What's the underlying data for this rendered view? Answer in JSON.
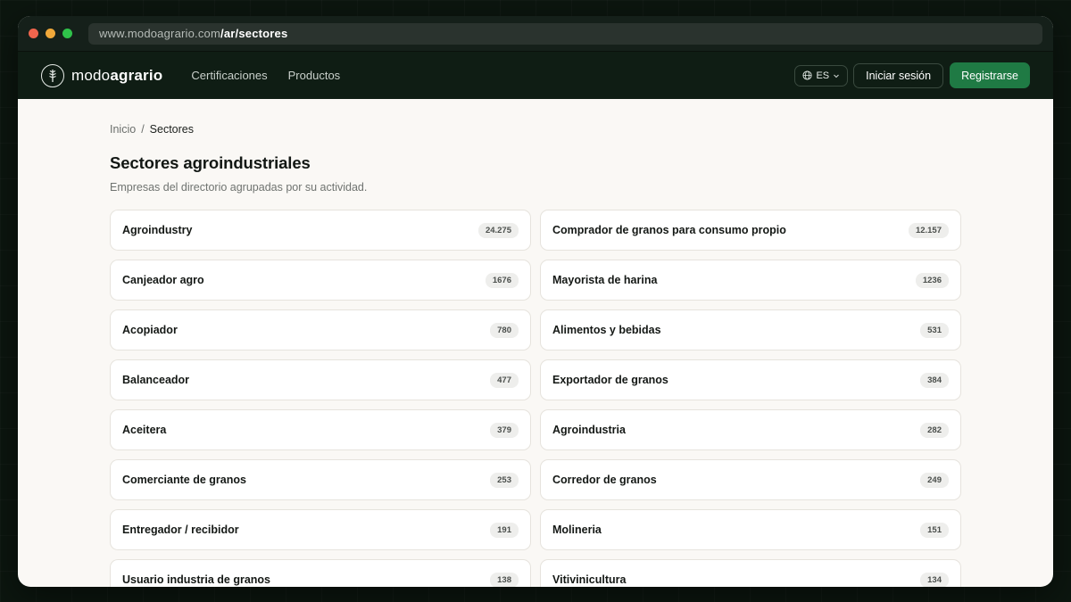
{
  "browser": {
    "url_host": "www.modoagrario.com",
    "url_path": "/ar/sectores"
  },
  "nav": {
    "logo_light": "modo",
    "logo_bold": "agrario",
    "links": [
      "Certificaciones",
      "Productos"
    ],
    "lang": "ES",
    "login": "Iniciar sesión",
    "register": "Registrarse"
  },
  "breadcrumb": {
    "home": "Inicio",
    "separator": "/",
    "current": "Sectores"
  },
  "page": {
    "title": "Sectores agroindustriales",
    "subtitle": "Empresas del directorio agrupadas por su actividad."
  },
  "sectors": [
    {
      "name": "Agroindustry",
      "count": "24.275"
    },
    {
      "name": "Comprador de granos para consumo propio",
      "count": "12.157"
    },
    {
      "name": "Canjeador agro",
      "count": "1676"
    },
    {
      "name": "Mayorista de harina",
      "count": "1236"
    },
    {
      "name": "Acopiador",
      "count": "780"
    },
    {
      "name": "Alimentos y bebidas",
      "count": "531"
    },
    {
      "name": "Balanceador",
      "count": "477"
    },
    {
      "name": "Exportador de granos",
      "count": "384"
    },
    {
      "name": "Aceitera",
      "count": "379"
    },
    {
      "name": "Agroindustria",
      "count": "282"
    },
    {
      "name": "Comerciante de granos",
      "count": "253"
    },
    {
      "name": "Corredor de granos",
      "count": "249"
    },
    {
      "name": "Entregador / recibidor",
      "count": "191"
    },
    {
      "name": "Molineria",
      "count": "151"
    },
    {
      "name": "Usuario industria de granos",
      "count": "138"
    },
    {
      "name": "Vitivinicultura",
      "count": "134"
    }
  ],
  "icons": {
    "logo": "wheat-icon",
    "lang": "globe-icon",
    "lang_caret": "chevron-down-icon"
  },
  "colors": {
    "accent": "#1f7a44",
    "nav_bg": "#0f1d14",
    "page_bg": "#faf8f5"
  }
}
